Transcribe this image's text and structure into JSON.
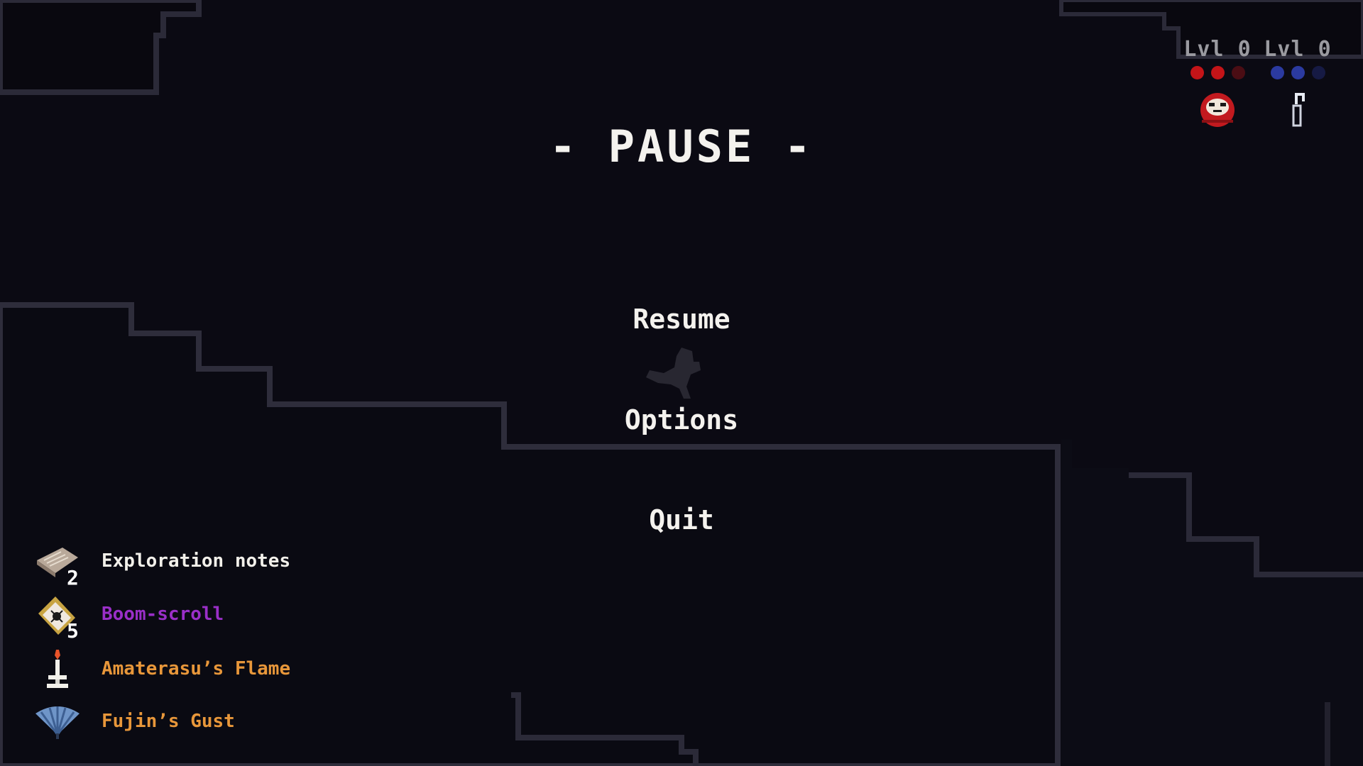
{
  "pause": {
    "title": "- PAUSE -"
  },
  "menu": {
    "resume_label": "Resume",
    "options_label": "Options",
    "quit_label": "Quit"
  },
  "hud": {
    "players": [
      {
        "level_text": "Lvl 0",
        "dot_color": "#c41418",
        "dots_filled": 2,
        "dots_total": 3,
        "icon": "daruma-icon"
      },
      {
        "level_text": "Lvl 0",
        "dot_color": "#2b3aa0",
        "dots_filled": 2,
        "dots_total": 3,
        "icon": "tool-figure-icon"
      }
    ]
  },
  "inventory": {
    "items": [
      {
        "label": "Exploration notes",
        "count": "2",
        "color": "#f2f0ea",
        "icon": "notes-icon"
      },
      {
        "label": "Boom-scroll",
        "count": "5",
        "color": "#9a2fc8",
        "icon": "scroll-icon"
      },
      {
        "label": "Amaterasu’s Flame",
        "count": "",
        "color": "#e8973a",
        "icon": "candle-icon"
      },
      {
        "label": "Fujin’s Gust",
        "count": "",
        "color": "#e8973a",
        "icon": "fan-icon"
      }
    ]
  }
}
